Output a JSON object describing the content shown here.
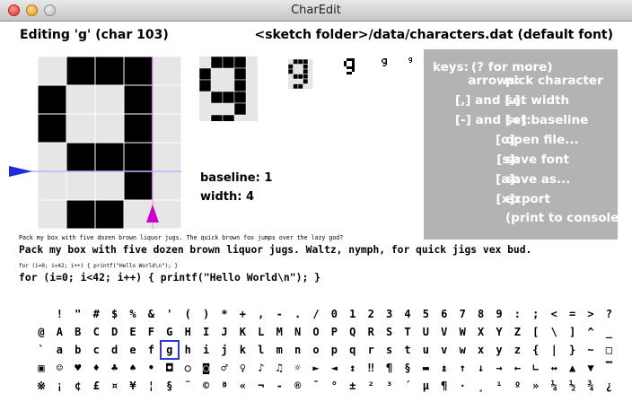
{
  "window": {
    "title": "CharEdit"
  },
  "header": {
    "editing": "Editing 'g' (char 103)",
    "file": "<sketch folder>/data/characters.dat (default font)"
  },
  "info": {
    "baseline": "baseline: 1",
    "width": "width: 4"
  },
  "keys": {
    "title": "keys:",
    "hint": "(? for more)",
    "rows": [
      {
        "key": "arrows:",
        "action": "pick character"
      },
      {
        "key": "[,] and [.]:",
        "action": "set width"
      },
      {
        "key": "[-] and [=]:",
        "action": "set baseline"
      },
      {
        "key": "[o]:",
        "action": "open file..."
      },
      {
        "key": "[s]:",
        "action": "save font"
      },
      {
        "key": "[a]:",
        "action": "save as..."
      },
      {
        "key": "[x]:",
        "action": "export"
      },
      {
        "key": "",
        "action": "(print to console)"
      }
    ]
  },
  "samples": {
    "small1": "Pack my box with five dozen brown liquor jugs. The quick brown fox jumps over the lazy god?",
    "large1": "Pack my box with five dozen brown liquor jugs. Waltz, nymph, for quick jigs vex bud.",
    "small2": "for (i=0; i<42; i++) { printf(\"Hello World\\n\"); }",
    "large2": "for (i=0; i<42; i++) { printf(\"Hello World\\n\"); }"
  },
  "charmap": {
    "rows": [
      [
        " ",
        "!",
        "\"",
        "#",
        "$",
        "%",
        "&",
        "'",
        "(",
        ")",
        "*",
        "+",
        ",",
        "-",
        ".",
        "/",
        "0",
        "1",
        "2",
        "3",
        "4",
        "5",
        "6",
        "7",
        "8",
        "9",
        ":",
        ";",
        "<",
        "=",
        ">",
        "?"
      ],
      [
        "@",
        "A",
        "B",
        "C",
        "D",
        "E",
        "F",
        "G",
        "H",
        "I",
        "J",
        "K",
        "L",
        "M",
        "N",
        "O",
        "P",
        "Q",
        "R",
        "S",
        "T",
        "U",
        "V",
        "W",
        "X",
        "Y",
        "Z",
        "[",
        "\\",
        "]",
        "^",
        "_"
      ],
      [
        "`",
        "a",
        "b",
        "c",
        "d",
        "e",
        "f",
        "g",
        "h",
        "i",
        "j",
        "k",
        "l",
        "m",
        "n",
        "o",
        "p",
        "q",
        "r",
        "s",
        "t",
        "u",
        "v",
        "w",
        "x",
        "y",
        "z",
        "{",
        "|",
        "}",
        "~",
        "□"
      ],
      [
        "▣",
        "☺",
        "♥",
        "♦",
        "♣",
        "♠",
        "•",
        "◘",
        "○",
        "◙",
        "♂",
        "♀",
        "♪",
        "♫",
        "☼",
        "►",
        "◄",
        "↕",
        "‼",
        "¶",
        "§",
        "▬",
        "↨",
        "↑",
        "↓",
        "→",
        "←",
        "∟",
        "↔",
        "▲",
        "▼",
        "▔"
      ],
      [
        "※",
        "¡",
        "¢",
        "£",
        "¤",
        "¥",
        "¦",
        "§",
        "¨",
        "©",
        "ª",
        "«",
        "¬",
        "-",
        "®",
        "¯",
        "°",
        "±",
        "²",
        "³",
        "´",
        "µ",
        "¶",
        "·",
        "¸",
        "¹",
        "º",
        "»",
        "¼",
        "½",
        "¾",
        "¿"
      ]
    ],
    "selected": "g"
  },
  "editor": {
    "bitmap": [
      [
        0,
        1,
        1,
        1,
        0
      ],
      [
        1,
        0,
        0,
        1,
        0
      ],
      [
        1,
        0,
        0,
        1,
        0
      ],
      [
        0,
        1,
        1,
        1,
        0
      ],
      [
        0,
        0,
        0,
        1,
        0
      ],
      [
        0,
        1,
        1,
        0,
        0
      ]
    ],
    "colors": {
      "on": "#000000",
      "off": "#e6e6e6",
      "guide": "#b7b7ff",
      "width_guide": "#ff9cff",
      "baseline_arrow": "#1f2bd6",
      "width_arrow": "#cc00cc"
    }
  }
}
